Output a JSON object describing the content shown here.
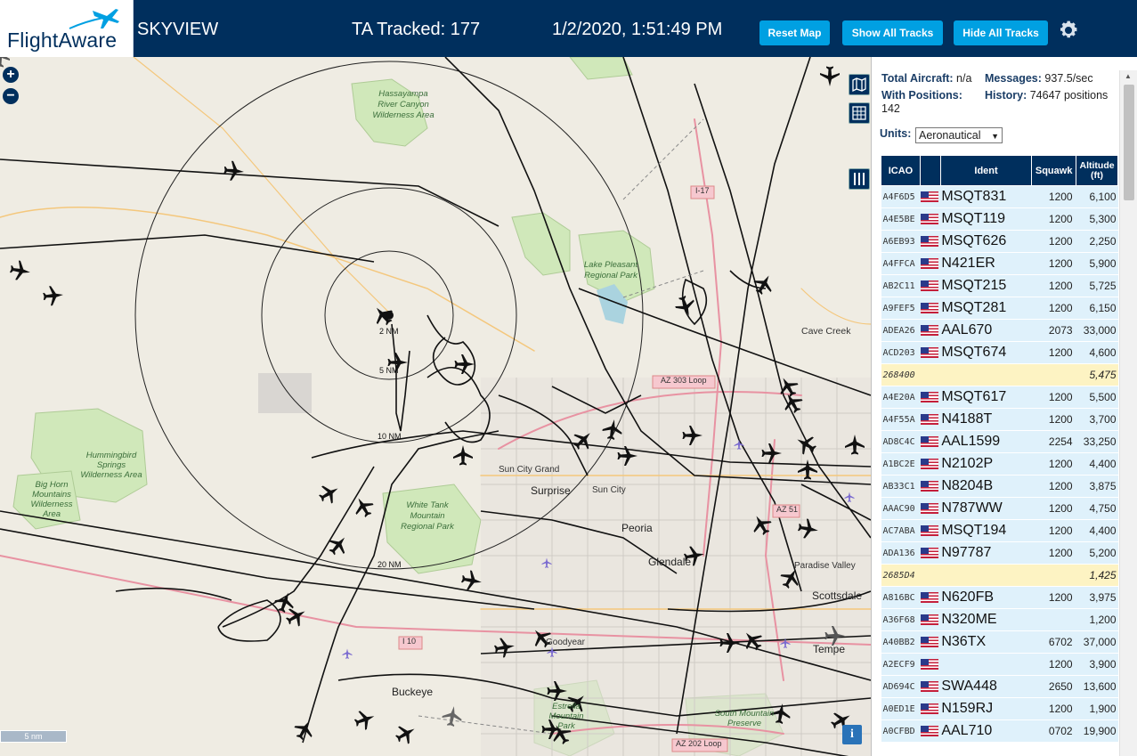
{
  "header": {
    "logo_text": "FlightAware",
    "app_title": "SKYVIEW",
    "tracked_text": "TA Tracked: 177",
    "clock_text": "1/2/2020, 1:51:49 PM",
    "buttons": {
      "reset": "Reset Map",
      "show_all": "Show All Tracks",
      "hide_all": "Hide All Tracks"
    },
    "settings_icon": "gear-icon"
  },
  "map": {
    "zoom_in": "+",
    "zoom_out": "−",
    "scale_label": "5 nm",
    "info_label": "i",
    "range_labels": [
      "2 NM",
      "5 NM",
      "10 NM",
      "20 NM"
    ],
    "place_labels": {
      "hassayampa": "Hassayampa River Canyon Wilderness Area",
      "lake_pleasant": "Lake Pleasant Regional Park",
      "cave_creek": "Cave Creek",
      "hummingbird": "Hummingbird Springs Wilderness Area",
      "big_horn": "Big Horn Mountains Wilderness Area",
      "white_tank": "White Tank Mountain Regional Park",
      "sun_city_grand": "Sun City Grand",
      "surprise": "Surprise",
      "sun_city": "Sun City",
      "peoria": "Peoria",
      "glendale": "Glendale",
      "paradise_valley": "Paradise Valley",
      "scottsdale": "Scottsdale",
      "goodyear": "Goodyear",
      "tempe": "Tempe",
      "buckeye": "Buckeye",
      "estrella": "Estrella Mountain Park",
      "south_mountain": "South Mountain Preserve"
    },
    "road_labels": [
      "I-17",
      "AZ 303 Loop",
      "AZ 51",
      "I 10",
      "AZ 202 Loop"
    ],
    "tool_icons": [
      "map-layers-icon",
      "grid-icon",
      "columns-icon"
    ]
  },
  "panel": {
    "total_aircraft_label": "Total Aircraft:",
    "total_aircraft_value": "n/a",
    "with_positions_label": "With Positions:",
    "with_positions_value": "142",
    "messages_label": "Messages:",
    "messages_value": "937.5/sec",
    "history_label": "History:",
    "history_value": "74647 positions",
    "units_label": "Units:",
    "units_value": "Aeronautical",
    "columns": {
      "icao": "ICAO",
      "flag": "",
      "ident": "Ident",
      "squawk": "Squawk",
      "altitude": "Altitude (ft)"
    },
    "rows": [
      {
        "icao": "A4F6D5",
        "flag": true,
        "ident": "MSQT831",
        "squawk": "1200",
        "alt": "6,100"
      },
      {
        "icao": "A4E5BE",
        "flag": true,
        "ident": "MSQT119",
        "squawk": "1200",
        "alt": "5,300"
      },
      {
        "icao": "A6EB93",
        "flag": true,
        "ident": "MSQT626",
        "squawk": "1200",
        "alt": "2,250"
      },
      {
        "icao": "A4FFCA",
        "flag": true,
        "ident": "N421ER",
        "squawk": "1200",
        "alt": "5,900"
      },
      {
        "icao": "AB2C11",
        "flag": true,
        "ident": "MSQT215",
        "squawk": "1200",
        "alt": "5,725"
      },
      {
        "icao": "A9FEF5",
        "flag": true,
        "ident": "MSQT281",
        "squawk": "1200",
        "alt": "6,150"
      },
      {
        "icao": "ADEA26",
        "flag": true,
        "ident": "AAL670",
        "squawk": "2073",
        "alt": "33,000"
      },
      {
        "icao": "ACD203",
        "flag": true,
        "ident": "MSQT674",
        "squawk": "1200",
        "alt": "4,600"
      },
      {
        "icao": "268400",
        "flag": false,
        "ident": "",
        "squawk": "",
        "alt": "5,475",
        "nopos": true
      },
      {
        "icao": "A4E20A",
        "flag": true,
        "ident": "MSQT617",
        "squawk": "1200",
        "alt": "5,500"
      },
      {
        "icao": "A4F55A",
        "flag": true,
        "ident": "N4188T",
        "squawk": "1200",
        "alt": "3,700"
      },
      {
        "icao": "AD8C4C",
        "flag": true,
        "ident": "AAL1599",
        "squawk": "2254",
        "alt": "33,250"
      },
      {
        "icao": "A1BC2E",
        "flag": true,
        "ident": "N2102P",
        "squawk": "1200",
        "alt": "4,400"
      },
      {
        "icao": "AB33C1",
        "flag": true,
        "ident": "N8204B",
        "squawk": "1200",
        "alt": "3,875"
      },
      {
        "icao": "AAAC90",
        "flag": true,
        "ident": "N787WW",
        "squawk": "1200",
        "alt": "4,750"
      },
      {
        "icao": "AC7ABA",
        "flag": true,
        "ident": "MSQT194",
        "squawk": "1200",
        "alt": "4,400"
      },
      {
        "icao": "ADA136",
        "flag": true,
        "ident": "N97787",
        "squawk": "1200",
        "alt": "5,200"
      },
      {
        "icao": "2685D4",
        "flag": false,
        "ident": "",
        "squawk": "",
        "alt": "1,425",
        "nopos": true
      },
      {
        "icao": "A816BC",
        "flag": true,
        "ident": "N620FB",
        "squawk": "1200",
        "alt": "3,975"
      },
      {
        "icao": "A36F68",
        "flag": true,
        "ident": "N320ME",
        "squawk": "",
        "alt": "1,200"
      },
      {
        "icao": "A40BB2",
        "flag": true,
        "ident": "N36TX",
        "squawk": "6702",
        "alt": "37,000"
      },
      {
        "icao": "A2ECF9",
        "flag": true,
        "ident": "",
        "squawk": "1200",
        "alt": "3,900"
      },
      {
        "icao": "AD694C",
        "flag": true,
        "ident": "SWA448",
        "squawk": "2650",
        "alt": "13,600"
      },
      {
        "icao": "A0ED1E",
        "flag": true,
        "ident": "N159RJ",
        "squawk": "1200",
        "alt": "1,900"
      },
      {
        "icao": "A0CFBD",
        "flag": true,
        "ident": "AAL710",
        "squawk": "0702",
        "alt": "19,900"
      }
    ]
  }
}
